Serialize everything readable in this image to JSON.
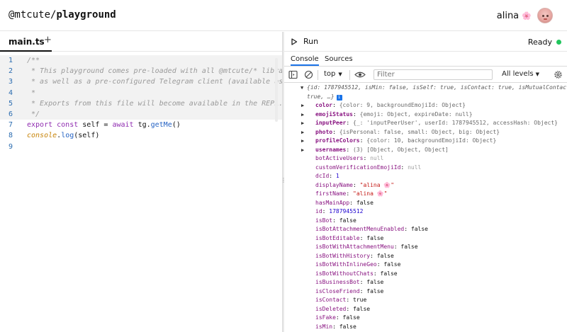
{
  "header": {
    "brand_scope": "@mtcute/",
    "brand_name": "playground",
    "user_name": "alina",
    "user_flower": "🌸"
  },
  "editor": {
    "tab_label": "main.ts",
    "add_tab_label": "+",
    "lines": [
      {
        "n": "1",
        "text": "/**"
      },
      {
        "n": "2",
        "text": " * This playground comes pre-loaded with all @mtcute/* librari"
      },
      {
        "n": "3",
        "text": " * as well as a pre-configured Telegram client (available as `"
      },
      {
        "n": "4",
        "text": " *"
      },
      {
        "n": "5",
        "text": " * Exports from this file will become available in the REPL."
      },
      {
        "n": "6",
        "text": " */"
      },
      {
        "n": "7",
        "kw1": "export const ",
        "id1": "self",
        "op": " = ",
        "kw2": "await ",
        "id2": "tg.",
        "fn": "getMe",
        "rest": "()"
      },
      {
        "n": "8",
        "it": "console",
        "dot": ".",
        "fn": "log",
        "rest": "(self)"
      },
      {
        "n": "9",
        "text": ""
      }
    ]
  },
  "runbar": {
    "run_label": "Run",
    "status_label": "Ready",
    "status_color": "#21c55d"
  },
  "devtools": {
    "tabs": [
      "Console",
      "Sources"
    ],
    "context": "top",
    "filter_placeholder": "Filter",
    "levels": "All levels"
  },
  "console": {
    "summary_line1": "{id: 1787945512, isMin: false, isSelf: true, isContact: true, isMutualContact:",
    "summary_line2": "true, …}",
    "expandable": [
      {
        "key": "color",
        "val": "{color: 9, backgroundEmojiId: Object}"
      },
      {
        "key": "emojiStatus",
        "val": "{emoji: Object, expireDate: null}"
      },
      {
        "key": "inputPeer",
        "val": "{_: 'inputPeerUser', userId: 1787945512, accessHash: Object}"
      },
      {
        "key": "photo",
        "val": "{isPersonal: false, small: Object, big: Object}"
      },
      {
        "key": "profileColors",
        "val": "{color: 10, backgroundEmojiId: Object}"
      },
      {
        "key": "usernames",
        "val": "(3) [Object, Object, Object]"
      }
    ],
    "props": [
      {
        "key": "botActiveUsers",
        "val": "null",
        "kind": "null"
      },
      {
        "key": "customVerificationEmojiId",
        "val": "null",
        "kind": "null"
      },
      {
        "key": "dcId",
        "val": "1",
        "kind": "num"
      },
      {
        "key": "displayName",
        "val": "\"alina 🌸\"",
        "kind": "str"
      },
      {
        "key": "firstName",
        "val": "\"alina 🌸\"",
        "kind": "str"
      },
      {
        "key": "hasMainApp",
        "val": "false",
        "kind": "bool"
      },
      {
        "key": "id",
        "val": "1787945512",
        "kind": "num"
      },
      {
        "key": "isBot",
        "val": "false",
        "kind": "bool"
      },
      {
        "key": "isBotAttachmentMenuEnabled",
        "val": "false",
        "kind": "bool"
      },
      {
        "key": "isBotEditable",
        "val": "false",
        "kind": "bool"
      },
      {
        "key": "isBotWithAttachmentMenu",
        "val": "false",
        "kind": "bool"
      },
      {
        "key": "isBotWithHistory",
        "val": "false",
        "kind": "bool"
      },
      {
        "key": "isBotWithInlineGeo",
        "val": "false",
        "kind": "bool"
      },
      {
        "key": "isBotWithoutChats",
        "val": "false",
        "kind": "bool"
      },
      {
        "key": "isBusinessBot",
        "val": "false",
        "kind": "bool"
      },
      {
        "key": "isCloseFriend",
        "val": "false",
        "kind": "bool"
      },
      {
        "key": "isContact",
        "val": "true",
        "kind": "bool"
      },
      {
        "key": "isDeleted",
        "val": "false",
        "kind": "bool"
      },
      {
        "key": "isFake",
        "val": "false",
        "kind": "bool"
      },
      {
        "key": "isMin",
        "val": "false",
        "kind": "bool"
      }
    ]
  }
}
